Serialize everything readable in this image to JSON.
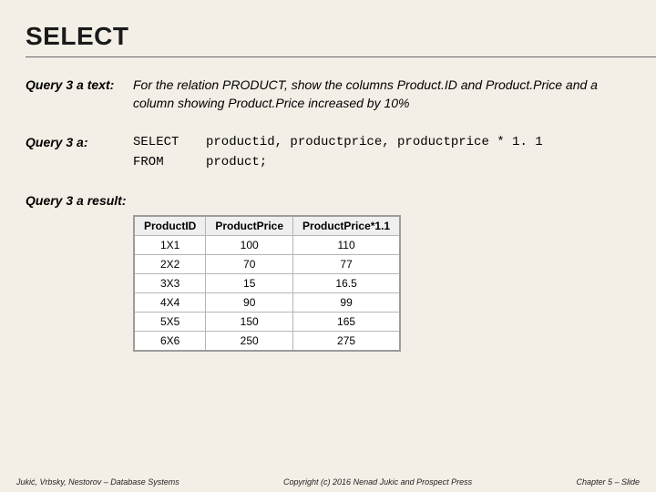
{
  "title": "SELECT",
  "q3a_text_label": "Query 3 a text:",
  "q3a_text_body": "For the relation PRODUCT, show the columns Product.ID and Product.Price and a column showing Product.Price increased by 10%",
  "q3a_label": "Query 3 a:",
  "sql": {
    "kw1": "SELECT",
    "line1": "productid, productprice, productprice * 1. 1",
    "kw2": "FROM",
    "line2": "product;"
  },
  "q3a_result_label": "Query 3 a result:",
  "table": {
    "headers": [
      "ProductID",
      "ProductPrice",
      "ProductPrice*1.1"
    ],
    "rows": [
      [
        "1X1",
        "100",
        "110"
      ],
      [
        "2X2",
        "70",
        "77"
      ],
      [
        "3X3",
        "15",
        "16.5"
      ],
      [
        "4X4",
        "90",
        "99"
      ],
      [
        "5X5",
        "150",
        "165"
      ],
      [
        "6X6",
        "250",
        "275"
      ]
    ]
  },
  "footer": {
    "left": "Jukić, Vrbsky, Nestorov – Database Systems",
    "center": "Copyright (c) 2016 Nenad Jukic and Prospect Press",
    "right": "Chapter 5 – Slide"
  },
  "chart_data": {
    "type": "table",
    "title": "Query 3a result",
    "columns": [
      "ProductID",
      "ProductPrice",
      "ProductPrice*1.1"
    ],
    "rows": [
      {
        "ProductID": "1X1",
        "ProductPrice": 100,
        "ProductPrice*1.1": 110
      },
      {
        "ProductID": "2X2",
        "ProductPrice": 70,
        "ProductPrice*1.1": 77
      },
      {
        "ProductID": "3X3",
        "ProductPrice": 15,
        "ProductPrice*1.1": 16.5
      },
      {
        "ProductID": "4X4",
        "ProductPrice": 90,
        "ProductPrice*1.1": 99
      },
      {
        "ProductID": "5X5",
        "ProductPrice": 150,
        "ProductPrice*1.1": 165
      },
      {
        "ProductID": "6X6",
        "ProductPrice": 250,
        "ProductPrice*1.1": 275
      }
    ]
  }
}
